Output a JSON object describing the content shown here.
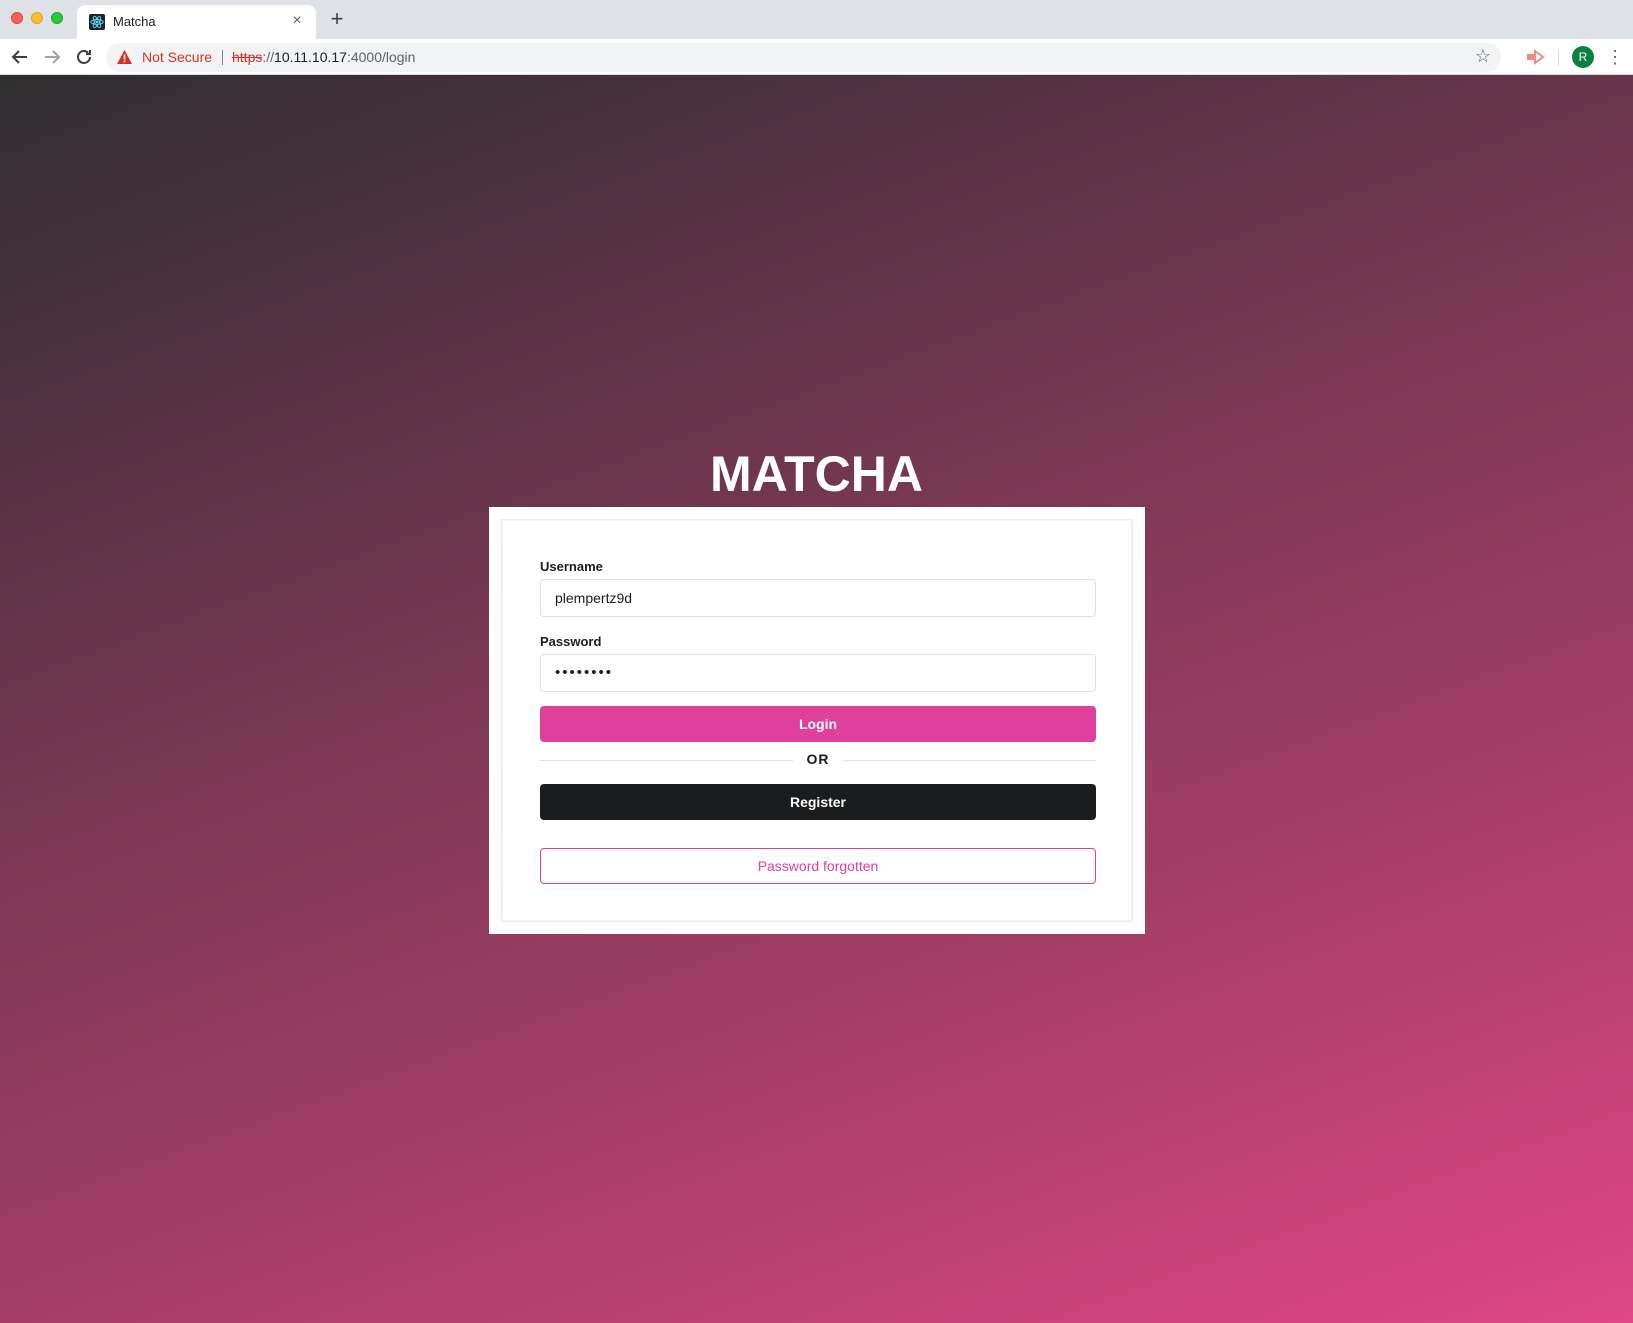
{
  "browser": {
    "tab_title": "Matcha",
    "tab_close": "×",
    "new_tab": "+",
    "security_label": "Not Secure",
    "url_scheme": "https",
    "url_scheme_sep": "://",
    "url_host": "10.11.10.17",
    "url_rest": ":4000/login",
    "profile_initial": "R",
    "icons": [
      "react-favicon-icon",
      "back-arrow-icon",
      "forward-arrow-icon",
      "reload-icon",
      "warning-icon",
      "bookmark-star-icon",
      "extension-icon",
      "kebab-menu-icon"
    ]
  },
  "page": {
    "brand": "MATCHA",
    "username_label": "Username",
    "username_value": "plempertz9d",
    "password_label": "Password",
    "password_value": "••••••••",
    "login_label": "Login",
    "divider_label": "OR",
    "register_label": "Register",
    "forgot_label": "Password forgotten"
  },
  "colors": {
    "accent": "#e0409b",
    "dark_button": "#1b1c1d",
    "gradient_start": "#2f2f30",
    "gradient_end": "#df4684",
    "insecure": "#d93025"
  }
}
